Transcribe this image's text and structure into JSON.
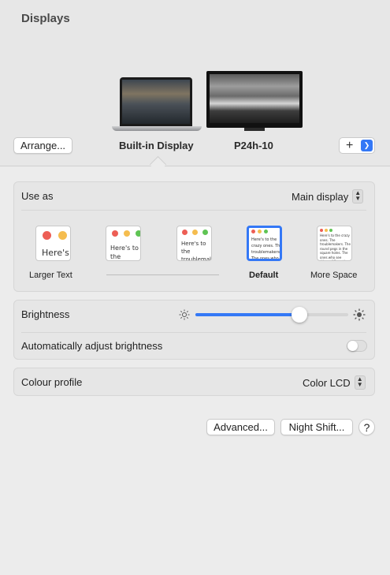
{
  "window": {
    "title": "Displays"
  },
  "displays": {
    "arrange_label": "Arrange...",
    "builtin_label": "Built-in Display",
    "external_label": "P24h-10",
    "add_label": "+"
  },
  "use_as": {
    "label": "Use as",
    "value": "Main display"
  },
  "resolution": {
    "larger_text": "Larger Text",
    "default": "Default",
    "more_space": "More Space",
    "sample_text_large": "Here's",
    "sample_text_2": "Here's to the troublemakers",
    "sample_text_3": "Here's to the troublemakers. The ones who see things",
    "sample_text_4": "Here's to the crazy ones. The troublemakers. The ones who see things differently. And they have no respect for the rules.",
    "sample_text_5": "Here's to the crazy ones. The troublemakers. The round pegs in the square holes. The ones who see things differently. They're not fond of rules. And they have no respect for the status quo. You can quote them. Disagree with them. Glorify or vilify them. About the only thing you can't do is ignore them. Because they change things."
  },
  "brightness": {
    "label": "Brightness",
    "level": 0.68
  },
  "auto_brightness": {
    "label": "Automatically adjust brightness",
    "on": false
  },
  "colour_profile": {
    "label": "Colour profile",
    "value": "Color LCD"
  },
  "footer": {
    "advanced_label": "Advanced...",
    "night_shift_label": "Night Shift...",
    "help_label": "?"
  },
  "colors": {
    "accent": "#3478f6",
    "close": "#ed5e55",
    "minimize": "#f5bd4f",
    "zoom": "#5fc454"
  }
}
